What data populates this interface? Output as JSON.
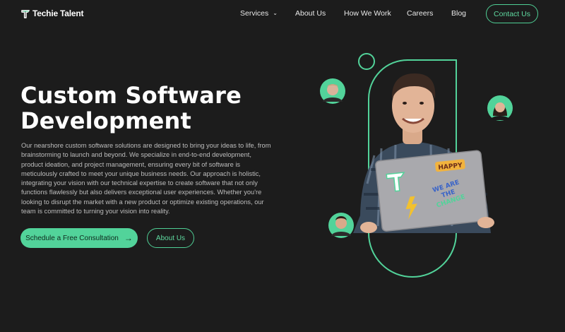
{
  "brand": {
    "name": "Techie Talent",
    "accent": "#52d39a"
  },
  "nav": {
    "items": [
      {
        "label": "Services",
        "has_dropdown": true
      },
      {
        "label": "About Us"
      },
      {
        "label": "How We Work"
      },
      {
        "label": "Careers"
      },
      {
        "label": "Blog"
      }
    ],
    "contact_label": "Contact Us"
  },
  "hero": {
    "title_line1": "Custom Software",
    "title_line2": "Development",
    "description": "Our nearshore custom software solutions are designed to bring your ideas to life, from brainstorming to launch and beyond. We specialize in end-to-end development, product ideation, and project management, ensuring every bit of software is meticulously crafted to meet your unique business needs. Our approach is holistic, integrating your vision with our technical expertise to create software that not only functions flawlessly but also delivers exceptional user experiences. Whether you're looking to disrupt the market with a new product or optimize existing operations, our team is committed to turning your vision into reality.",
    "cta_primary": "Schedule a Free Consultation",
    "cta_secondary": "About Us"
  },
  "illustration": {
    "sticker_happy": "HAPPY",
    "sticker_change_1": "WE ARE",
    "sticker_change_2": "THE",
    "sticker_change_3": "CHANGE"
  }
}
